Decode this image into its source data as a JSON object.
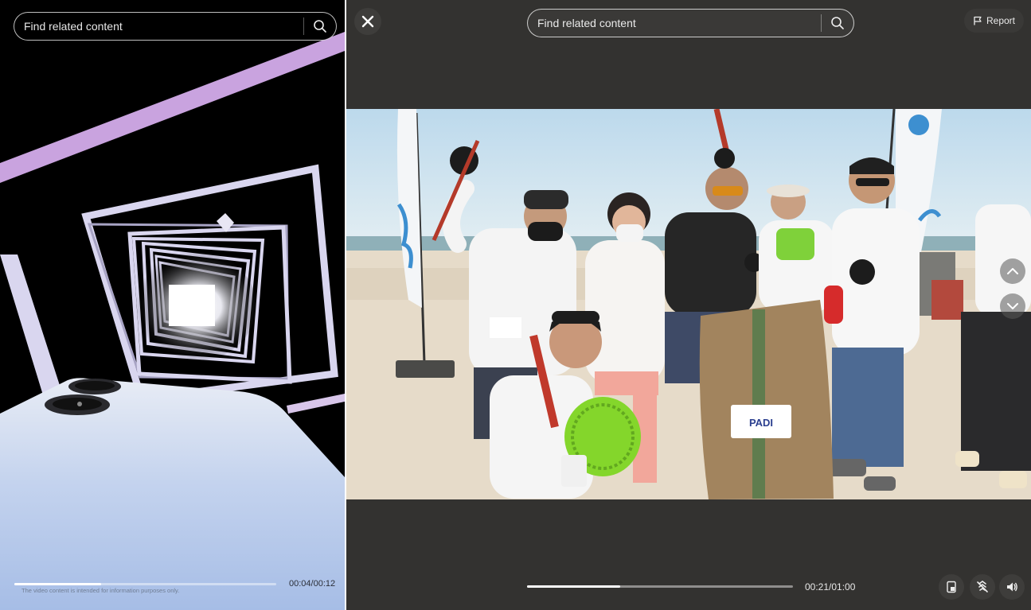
{
  "left_player": {
    "search": {
      "placeholder": "Find related content",
      "button_icon": "search-icon"
    },
    "progress": {
      "current": "00:04",
      "total": "00:12",
      "time_label": "00:04/00:12",
      "fraction": 0.33
    },
    "disclaimer": "The video content is intended for information purposes only."
  },
  "right_player": {
    "close_icon": "close-icon",
    "search": {
      "placeholder": "Find related content",
      "button_icon": "search-icon"
    },
    "report": {
      "label": "Report",
      "icon": "flag-icon"
    },
    "nav": {
      "prev_icon": "chevron-up-icon",
      "next_icon": "chevron-down-icon"
    },
    "progress": {
      "current": "00:21",
      "total": "01:00",
      "time_label": "00:21/01:00",
      "fraction": 0.35
    },
    "controls": {
      "picture_in_picture_icon": "pip-icon",
      "autoscroll_off_icon": "autoscroll-off-icon",
      "volume_icon": "volume-icon"
    },
    "banner_text": "PADI"
  },
  "colors": {
    "panel_bg": "#333230",
    "left_bg": "#000000",
    "accent_lilac": "#c9a0dc",
    "sky": "#cde3ef",
    "sand": "#e8dccb"
  }
}
